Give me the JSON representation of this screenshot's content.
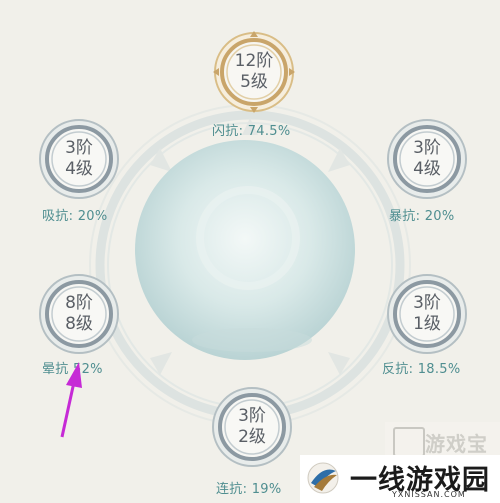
{
  "nodes": {
    "top": {
      "tier": "12阶",
      "level": "5级",
      "stat": "闪抗: 74.5%"
    },
    "upper_left": {
      "tier": "3阶",
      "level": "4级",
      "stat": "吸抗: 20%"
    },
    "upper_right": {
      "tier": "3阶",
      "level": "4级",
      "stat": "暴抗: 20%"
    },
    "lower_left": {
      "tier": "8阶",
      "level": "8级",
      "stat": "晕抗  52%"
    },
    "lower_right": {
      "tier": "3阶",
      "level": "1级",
      "stat": "反抗: 18.5%"
    },
    "bottom": {
      "tier": "3阶",
      "level": "2级",
      "stat": "连抗: 19%"
    }
  },
  "watermarks": {
    "youxibao": "游戏宝",
    "site_title": "一线游戏园",
    "site_url": "YXNISSAN.COM"
  },
  "colors": {
    "background": "#f1f0ea",
    "stat_text": "#4f8e90",
    "node_ring": "#8c99a2",
    "node_ring_gold": "#c9a56a",
    "arrow": "#c62ad6",
    "orb": "#cfe2e2"
  }
}
